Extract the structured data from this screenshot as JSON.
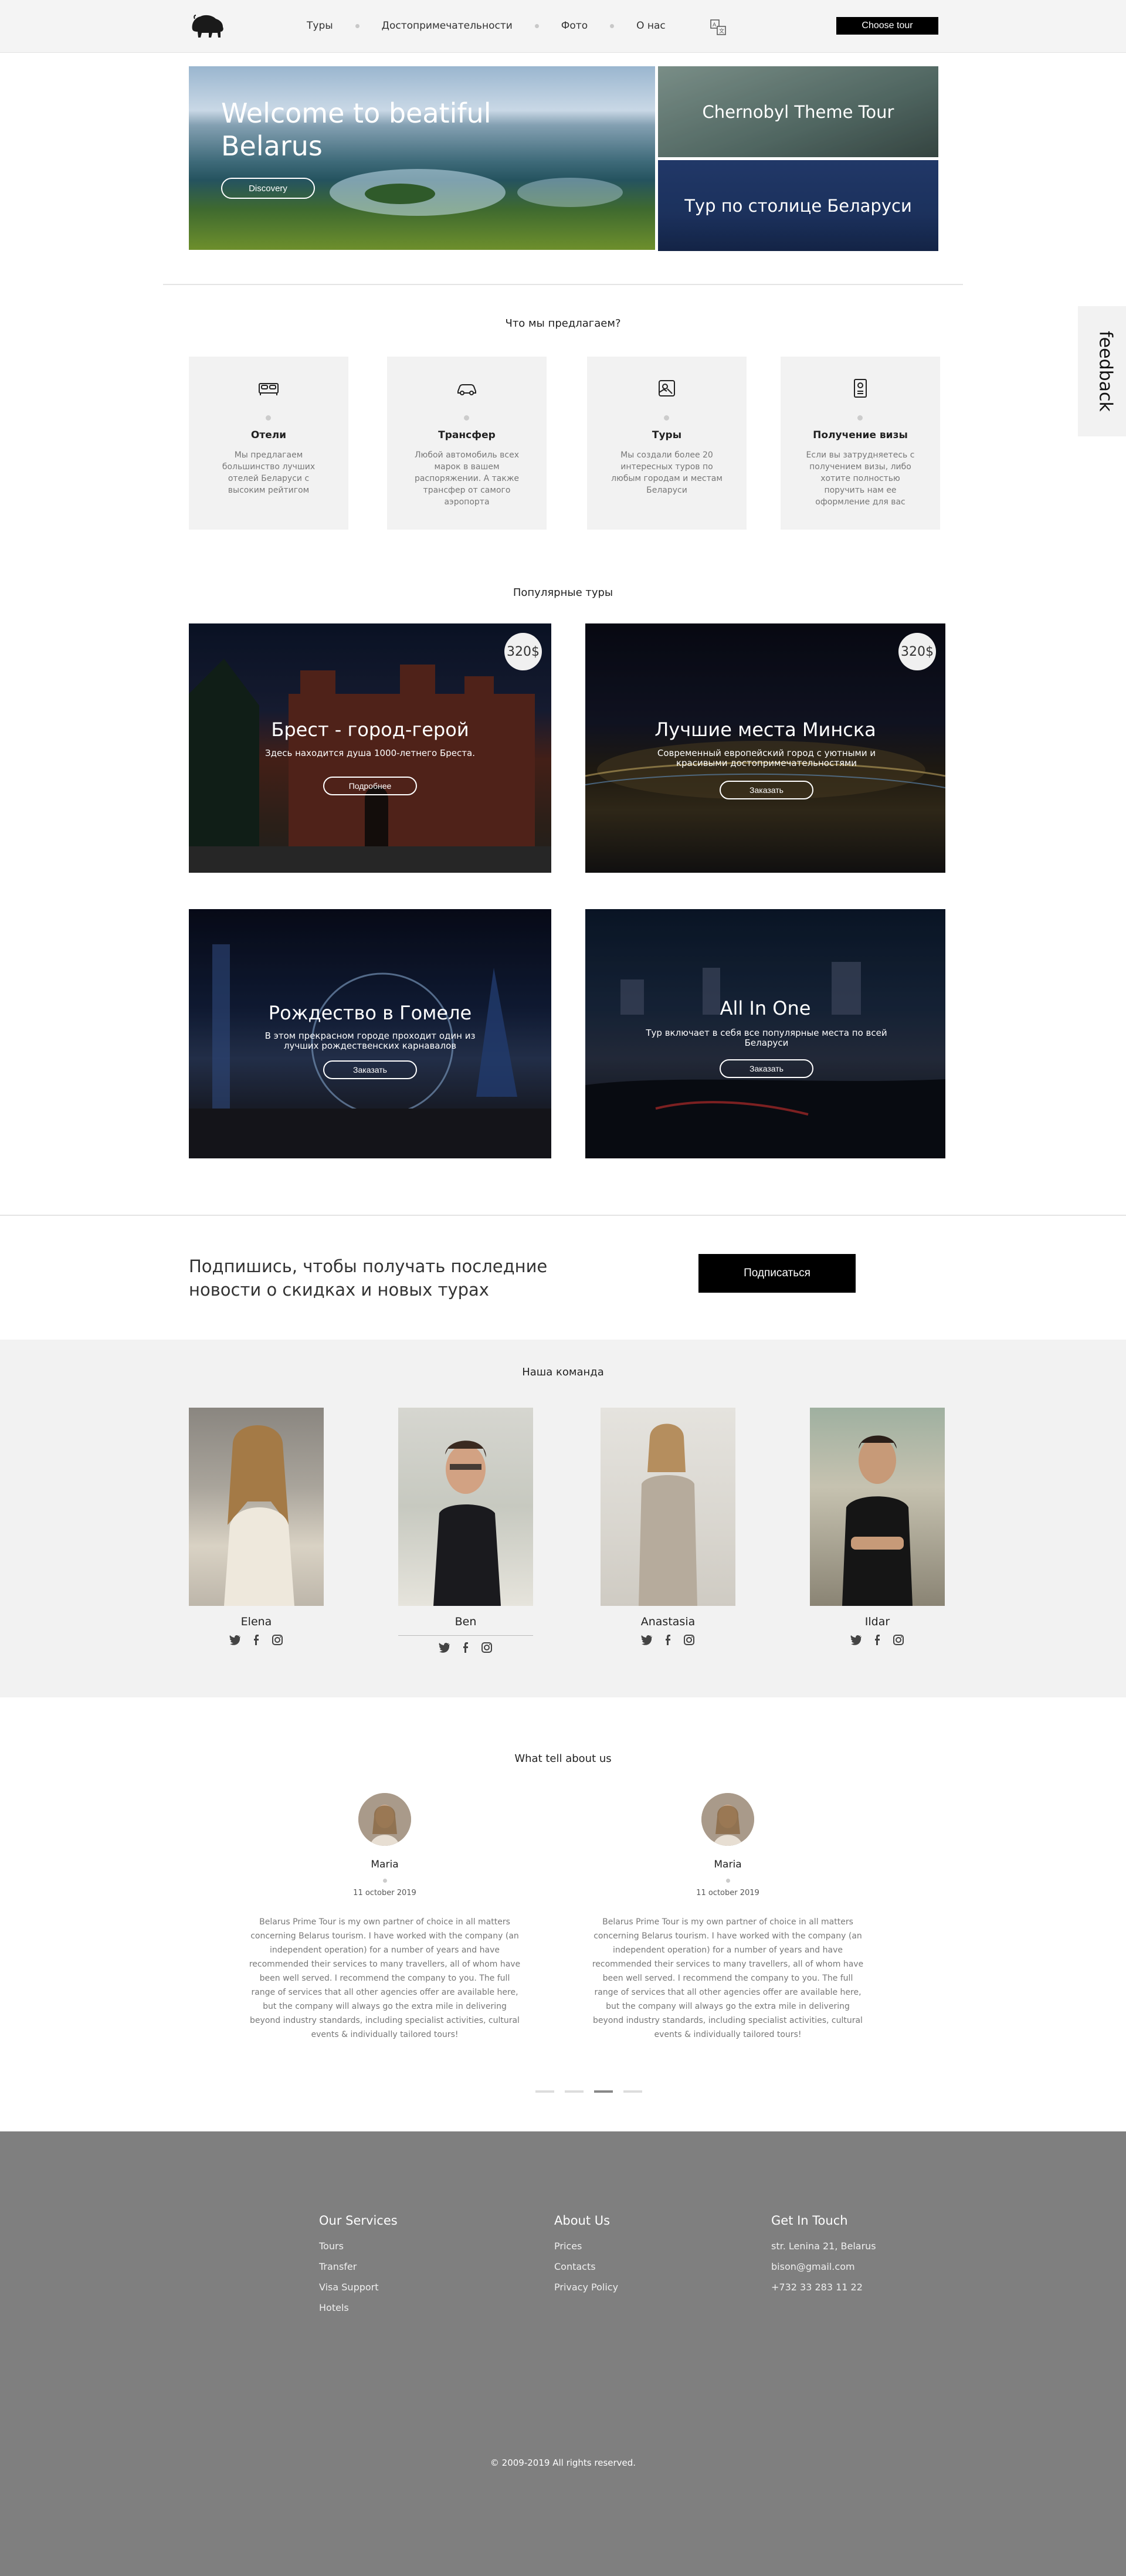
{
  "header": {
    "nav": [
      "Туры",
      "Достопримечательности",
      "Фото",
      "О нас"
    ],
    "choose_tour": "Choose tour"
  },
  "hero": {
    "title": "Welcome to beatiful Belarus",
    "discovery": "Discovery",
    "side_top": "Chernobyl Theme Tour",
    "side_bottom": "Тур по столице Беларуси"
  },
  "offers": {
    "title": "Что мы предлагаем?",
    "cards": [
      {
        "icon": "bed-icon",
        "title": "Отели",
        "text": "Мы предлагаем большинство лучших отелей Беларуси с высоким рейтигом"
      },
      {
        "icon": "car-icon",
        "title": "Трансфер",
        "text": "Любой автомобиль всех марок в вашем распоряжении. А также трансфер от самого аэропорта"
      },
      {
        "icon": "map-icon",
        "title": "Туры",
        "text": "Мы создали более 20 интересных туров по любым городам и местам Беларуси"
      },
      {
        "icon": "passport-icon",
        "title": "Получение визы",
        "text": "Если вы затрудняетесь с получением визы, либо хотите полностью поручить нам ее оформление для вас"
      }
    ]
  },
  "tours": {
    "title": "Популярные туры",
    "items": [
      {
        "title": "Брест - город-герой",
        "text": "Здесь находится душа 1000-летнего Бреста.",
        "button": "Подробнее",
        "price": "320$"
      },
      {
        "title": "Лучшие места Минска",
        "text": "Современный европейский город с уютными и красивыми достопримечательностями",
        "button": "Заказать",
        "price": "320$"
      },
      {
        "title": "Рождество в Гомеле",
        "text": "В этом прекрасном городе проходит один из лучших рождественских карнавалов",
        "button": "Заказать",
        "price": ""
      },
      {
        "title": "All In One",
        "text": "Тур включает в себя все популярные места по всей Беларуси",
        "button": "Заказать",
        "price": ""
      }
    ]
  },
  "subscribe": {
    "text": "Подпишись, чтобы получать последние новости о скидках и новых турах",
    "button": "Подписаться"
  },
  "team": {
    "title": "Наша команда",
    "members": [
      "Elena",
      "Ben",
      "Anastasia",
      "Ildar"
    ]
  },
  "reviews": {
    "title": "What tell about us",
    "items": [
      {
        "name": "Maria",
        "date": "11 october 2019",
        "text": "Belarus Prime Tour is my own partner of choice in all matters concerning Belarus tourism. I have worked with the company (an independent operation) for a number of years and have recommended their services to many travellers, all of whom have been well served. I recommend the company to you. The full range of services that all other agencies offer are available here, but the company will always go the extra mile in delivering beyond industry standards, including specialist activities, cultural events & individually tailored tours!"
      },
      {
        "name": "Maria",
        "date": "11 october 2019",
        "text": "Belarus Prime Tour is my own partner of choice in all matters concerning Belarus tourism. I have worked with the company (an independent operation) for a number of years and have recommended their services to many travellers, all of whom have been well served. I recommend the company to you. The full range of services that all other agencies offer are available here, but the company will always go the extra mile in delivering beyond industry standards, including specialist activities, cultural events & individually tailored tours!"
      }
    ],
    "active_slide": 3
  },
  "footer": {
    "services_title": "Our Services",
    "services": [
      "Tours",
      "Transfer",
      "Visa Support",
      "Hotels"
    ],
    "about_title": "About Us",
    "about": [
      "Prices",
      "Contacts",
      "Privacy Policy"
    ],
    "contact_title": "Get In Touch",
    "contact": [
      "str. Lenina 21, Belarus",
      "bison@gmail.com",
      "+732 33 283 11 22"
    ],
    "copyright": "© 2009-2019 All rights reserved."
  },
  "feedback": "feedback"
}
